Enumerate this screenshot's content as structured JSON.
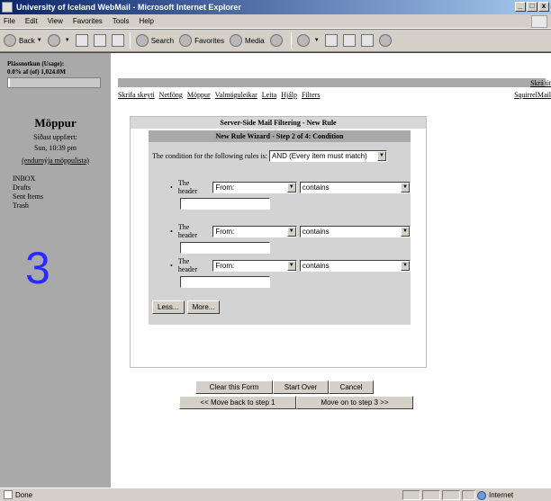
{
  "window": {
    "title": "University of Iceland WebMail - Microsoft Internet Explorer",
    "controls": [
      "_",
      "□",
      "x"
    ]
  },
  "menubar": [
    "File",
    "Edit",
    "View",
    "Favorites",
    "Tools",
    "Help"
  ],
  "toolbar": {
    "back": "Back",
    "search": "Search",
    "favorites": "Favorites",
    "media": "Media"
  },
  "leftpane": {
    "quota_label": "Plássnotkun (Usage):",
    "quota_value": "0.0% af (of) 1,024.0M",
    "quota_percent": 0.0,
    "folder_title": "Möppur",
    "last_refresh": "Síðast uppfært:",
    "refresh_time": "Sun, 10:39 pm",
    "refresh_link": "(endurnýja möppulista)",
    "folders": [
      "INBOX",
      "Drafts",
      "Sent Items",
      "Trash"
    ],
    "big_number": "3"
  },
  "nav": {
    "signout": "Skrá út",
    "links": [
      "Skrifa skeyti",
      "Netföng",
      "Möppur",
      "Valmöguleikar",
      "Leita",
      "Hjálp",
      "Filters"
    ],
    "brand_link": "SquirrelMail"
  },
  "filter": {
    "panel_title": "Server-Side Mail Filtering - New Rule",
    "wizard_title": "New Rule Wizard - Step 2 of 4: Condition",
    "condition_label": "The condition for the following rules is:",
    "condition_value": "AND (Every item must match)",
    "rules": [
      {
        "label": "The header",
        "header": "From:",
        "operator": "contains",
        "value": ""
      },
      {
        "label": "The header",
        "header": "From:",
        "operator": "contains",
        "value": ""
      },
      {
        "label": "The header",
        "header": "From:",
        "operator": "contains",
        "value": ""
      }
    ],
    "less_button": "Less...",
    "more_button": "More...",
    "clear_button": "Clear this Form",
    "start_over_button": "Start Over",
    "cancel_button": "Cancel",
    "back_button": "<< Move back to step 1",
    "next_button": "Move on to step 3 >>"
  },
  "statusbar": {
    "status": "Done",
    "zone": "Internet"
  }
}
